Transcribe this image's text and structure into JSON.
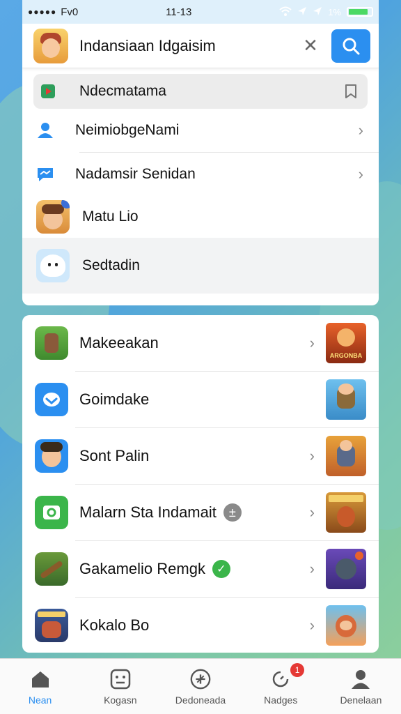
{
  "status_bar": {
    "carrier": "Fv0",
    "time": "11-13",
    "battery": "1%"
  },
  "search": {
    "query": "Indansiaan Idgaisim"
  },
  "suggestions": [
    {
      "label": "Ndecmatama"
    },
    {
      "label": "NeimiobgeNami"
    },
    {
      "label": "Nadamsir Senidan"
    },
    {
      "label": "Matu Lio"
    },
    {
      "label": "Sedtadin"
    }
  ],
  "results": [
    {
      "label": "Makeeakan",
      "thumb_text": "ARGONBA"
    },
    {
      "label": "Goimdake"
    },
    {
      "label": "Sont Palin"
    },
    {
      "label": "Malarn Sta Indamait",
      "badge": "±"
    },
    {
      "label": "Gakamelio Remgk",
      "badge": "✓"
    },
    {
      "label": "Kokalo Bo"
    }
  ],
  "tabs": [
    {
      "label": "Nean",
      "icon": "home-icon",
      "active": true
    },
    {
      "label": "Kogasn",
      "icon": "face-icon"
    },
    {
      "label": "Dedoneada",
      "icon": "compass-icon"
    },
    {
      "label": "Nadges",
      "icon": "refresh-icon",
      "badge": "1"
    },
    {
      "label": "Denelaan",
      "icon": "person-icon"
    }
  ],
  "colors": {
    "accent": "#2b8ff0",
    "badge_red": "#e53935",
    "verified_green": "#3bb54a"
  }
}
